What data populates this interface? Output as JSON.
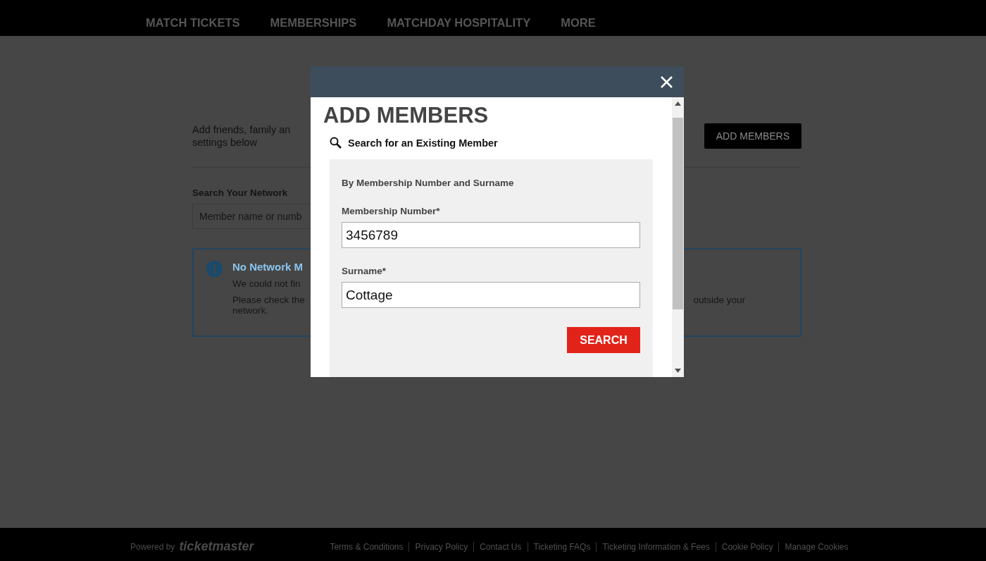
{
  "nav": {
    "items": [
      "MATCH TICKETS",
      "MEMBERSHIPS",
      "MATCHDAY HOSPITALITY",
      "MORE"
    ]
  },
  "network": {
    "intro_lines": [
      "Add friends, family an",
      "settings below"
    ],
    "add_button": "ADD MEMBERS",
    "search_label": "Search Your Network",
    "search_placeholder": "Member name or numb",
    "notice": {
      "title": "No Network M",
      "line_1": "We could not fin",
      "line_2_left": "Please check the",
      "line_2_right": "outside your",
      "line_3": "network."
    }
  },
  "modal": {
    "title": "ADD MEMBERS",
    "subtitle": "Search for an Existing Member",
    "panel_heading": "By Membership Number and Surname",
    "fields": [
      {
        "label": "Membership Number*",
        "value": "3456789"
      },
      {
        "label": "Surname*",
        "value": "Cottage"
      }
    ],
    "search_button": "SEARCH"
  },
  "footer": {
    "powered_by": "Powered by",
    "brand": "ticketmaster",
    "links": [
      "Terms & Conditions",
      "Privacy Policy",
      "Contact Us",
      "Ticketing FAQs",
      "Ticketing Information & Fees",
      "Cookie Policy",
      "Manage Cookies"
    ]
  }
}
